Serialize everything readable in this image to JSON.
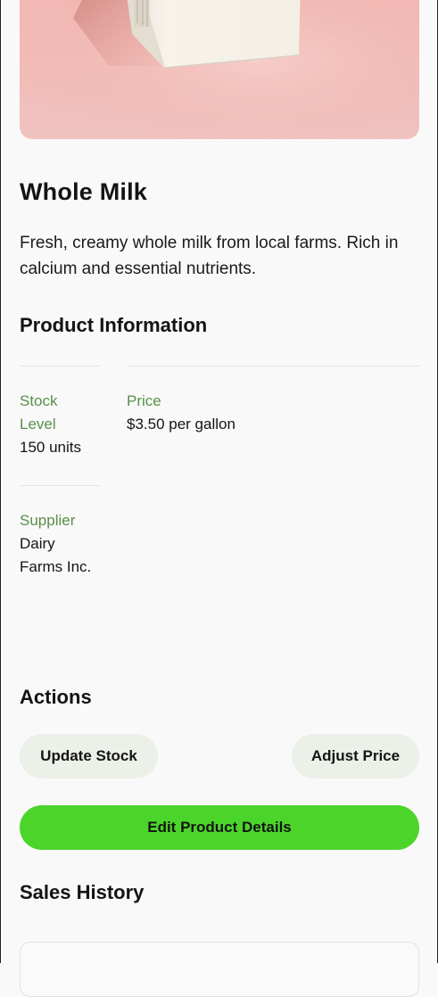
{
  "product": {
    "name": "Whole Milk",
    "description": "Fresh, creamy whole milk from local farms. Rich in calcium and essential nutrients.",
    "image_alt": "milk-carton-image"
  },
  "info": {
    "heading": "Product Information",
    "stock_label_1": "Stock",
    "stock_label_2": "Level",
    "stock_value": "150 units",
    "price_label": "Price",
    "price_value": "$3.50 per gallon",
    "supplier_label": "Supplier",
    "supplier_value_1": "Dairy",
    "supplier_value_2": "Farms Inc."
  },
  "actions": {
    "heading": "Actions",
    "update_stock": "Update Stock",
    "adjust_price": "Adjust Price",
    "edit_details": "Edit Product Details"
  },
  "sales": {
    "heading": "Sales History"
  },
  "colors": {
    "accent_green": "#4bd52b",
    "label_green": "#5a8f4a",
    "pill_bg": "#ebf0e8",
    "hero_bg": "#f2b6b1"
  }
}
